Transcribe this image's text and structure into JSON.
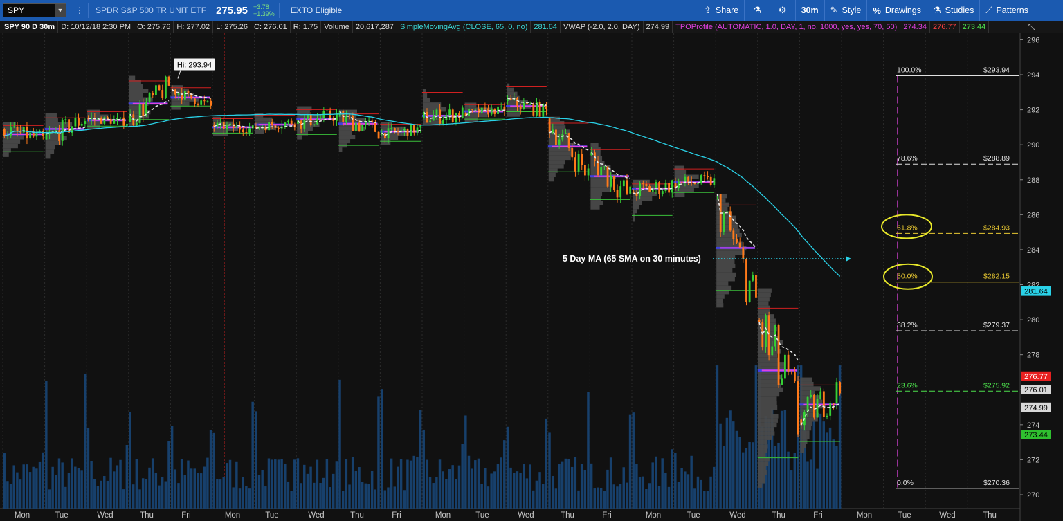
{
  "toolbar": {
    "symbol": "SPY",
    "description": "SPDR S&P 500 TR UNIT ETF",
    "last": "275.95",
    "change": "+3.78",
    "change_pct": "+1.39%",
    "exto": "EXTO Eligible",
    "share": "Share",
    "timeframe": "30m",
    "style": "Style",
    "drawings": "Drawings",
    "studies": "Studies",
    "patterns": "Patterns"
  },
  "studybar": {
    "symbol_label": "SPY 90 D 30m",
    "date": "D: 10/12/18 2:30 PM",
    "open": "O: 275.76",
    "high": "H: 277.02",
    "low": "L: 275.26",
    "close": "C: 276.01",
    "range": "R: 1.75",
    "volume_label": "Volume",
    "volume_value": "20,617,287",
    "sma_label": "SimpleMovingAvg (CLOSE, 65, 0, no)",
    "sma_value": "281.64",
    "vwap_label": "VWAP (-2.0, 2.0, DAY)",
    "vwap_value": "274.99",
    "tpo_label": "TPOProfile (AUTOMATIC, 1.0, DAY, 1, no, 1000, yes, yes, 70, 50)",
    "tpo_v1": "274.34",
    "tpo_v2": "276.77",
    "tpo_v3": "273.44"
  },
  "chart_data": {
    "type": "candlestick",
    "ylim": [
      270,
      296
    ],
    "y_ticks": [
      270,
      272,
      274,
      276,
      278,
      280,
      282,
      284,
      286,
      288,
      290,
      292,
      294,
      296
    ],
    "x_day_labels": [
      "Mon",
      "Tue",
      "Wed",
      "Thu",
      "Fri",
      "Mon",
      "Tue",
      "Wed",
      "Thu",
      "Fri",
      "Mon",
      "Tue",
      "Wed",
      "Thu",
      "Fri",
      "Mon",
      "Tue",
      "Wed",
      "Thu"
    ],
    "daily": [
      {
        "o": 290.9,
        "h": 291.3,
        "l": 289.3,
        "c": 290.3
      },
      {
        "o": 290.3,
        "h": 291.8,
        "l": 289.2,
        "c": 291.5
      },
      {
        "o": 291.5,
        "h": 292.0,
        "l": 290.9,
        "c": 291.3
      },
      {
        "o": 291.3,
        "h": 293.94,
        "l": 291.0,
        "c": 293.4
      },
      {
        "o": 293.2,
        "h": 293.4,
        "l": 292.0,
        "c": 292.2
      },
      {
        "o": 291.1,
        "h": 291.6,
        "l": 290.5,
        "c": 290.9
      },
      {
        "o": 291.0,
        "h": 291.8,
        "l": 290.6,
        "c": 291.3
      },
      {
        "o": 291.2,
        "h": 292.2,
        "l": 290.3,
        "c": 291.7
      },
      {
        "o": 291.6,
        "h": 292.0,
        "l": 289.6,
        "c": 290.8
      },
      {
        "o": 290.6,
        "h": 291.3,
        "l": 290.0,
        "c": 290.9
      },
      {
        "o": 291.5,
        "h": 293.2,
        "l": 291.1,
        "c": 291.8
      },
      {
        "o": 291.8,
        "h": 292.4,
        "l": 291.3,
        "c": 292.0
      },
      {
        "o": 292.5,
        "h": 293.5,
        "l": 291.6,
        "c": 291.9
      },
      {
        "o": 291.5,
        "h": 291.6,
        "l": 287.9,
        "c": 288.3
      },
      {
        "o": 289.4,
        "h": 290.1,
        "l": 286.3,
        "c": 287.0
      },
      {
        "o": 287.3,
        "h": 288.0,
        "l": 285.6,
        "c": 287.7
      },
      {
        "o": 287.8,
        "h": 288.8,
        "l": 287.0,
        "c": 287.9
      },
      {
        "o": 287.2,
        "h": 287.2,
        "l": 280.7,
        "c": 281.0
      },
      {
        "o": 280.0,
        "h": 281.8,
        "l": 270.4,
        "c": 274.2
      },
      {
        "o": 274.3,
        "h": 276.7,
        "l": 272.4,
        "c": 276.0
      }
    ],
    "volume_max": 48000000,
    "sma_value": "281.64",
    "vwap_value": "274.99",
    "price_tags": [
      {
        "value": 276.77,
        "label": "276.77",
        "color": "#e82020",
        "text": "#fff"
      },
      {
        "value": 276.01,
        "label": "276.01",
        "color": "#d8d8d8",
        "text": "#000"
      },
      {
        "value": 274.99,
        "label": "274.99",
        "color": "#d8d8d8",
        "text": "#000"
      },
      {
        "value": 273.44,
        "label": "273.44",
        "color": "#2fc02f",
        "text": "#000"
      },
      {
        "value": 281.64,
        "label": "281.64",
        "color": "#2ad2e8",
        "text": "#000"
      }
    ],
    "fib_levels": [
      {
        "pct": "100.0%",
        "value": 293.94,
        "label": "$293.94",
        "style": "solid",
        "color": "#e0e0e0"
      },
      {
        "pct": "78.6%",
        "value": 288.89,
        "label": "$288.89",
        "style": "dash",
        "color": "#e0e0e0"
      },
      {
        "pct": "61.8%",
        "value": 284.93,
        "label": "$284.93",
        "style": "dash",
        "color": "#e8c832"
      },
      {
        "pct": "50.0%",
        "value": 282.15,
        "label": "$282.15",
        "style": "solid",
        "color": "#e8c832"
      },
      {
        "pct": "38.2%",
        "value": 279.37,
        "label": "$279.37",
        "style": "dash",
        "color": "#e0e0e0"
      },
      {
        "pct": "23.6%",
        "value": 275.92,
        "label": "$275.92",
        "style": "dash",
        "color": "#4ce04c"
      },
      {
        "pct": "0.0%",
        "value": 270.36,
        "label": "$270.36",
        "style": "solid",
        "color": "#e0e0e0"
      }
    ],
    "hi_label": "Hi: 293.94",
    "annotation": "5 Day MA (65 SMA on 30 minutes)"
  }
}
